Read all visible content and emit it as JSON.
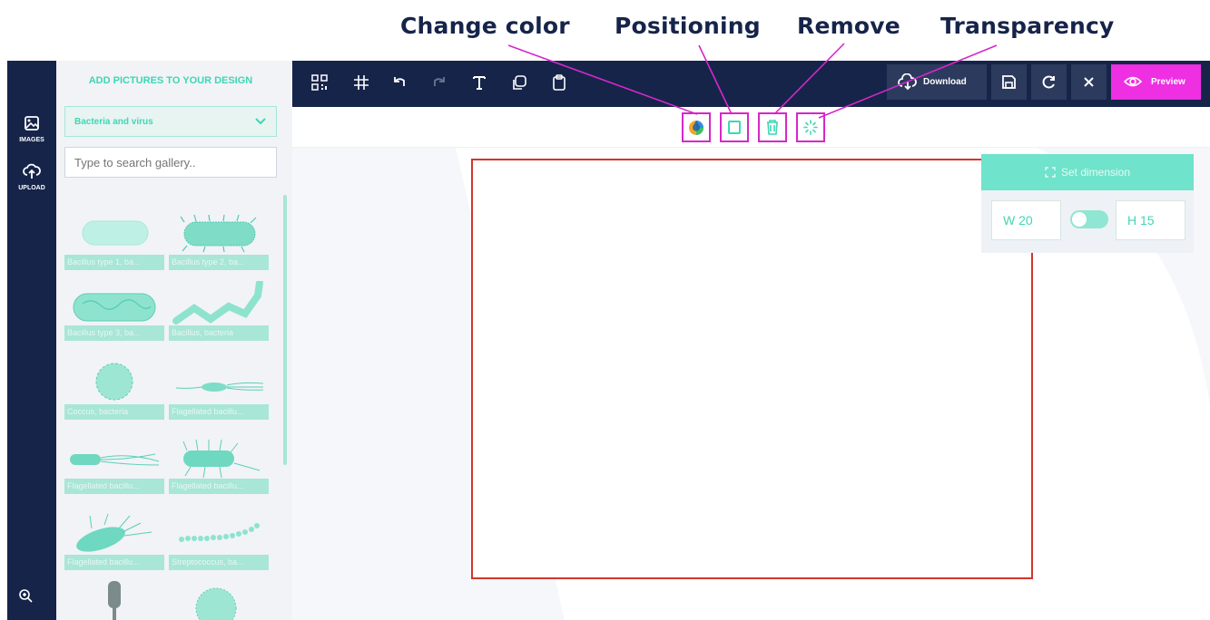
{
  "callouts": {
    "change_color": "Change color",
    "positioning": "Positioning",
    "remove": "Remove",
    "transparency": "Transparency"
  },
  "rail": {
    "images_label": "IMAGES",
    "upload_label": "UPLOAD",
    "icons": [
      "image-icon",
      "upload-cloud-icon",
      "zoom-in-icon"
    ]
  },
  "panel": {
    "title": "ADD PICTURES TO YOUR DESIGN",
    "category_selected": "Bacteria and virus",
    "search_placeholder": "Type to search gallery..",
    "items": [
      {
        "caption": "Bacillus type 1, ba...",
        "icon": "bacillus-smooth-icon"
      },
      {
        "caption": "Bacillus type 2, ba...",
        "icon": "bacillus-hairy-icon"
      },
      {
        "caption": "Bacillus type 3, ba...",
        "icon": "bacillus-wrinkled-icon"
      },
      {
        "caption": "Bacillus, bacteria",
        "icon": "bacillus-chain-icon"
      },
      {
        "caption": "Coccus, bacteria",
        "icon": "coccus-icon"
      },
      {
        "caption": "Flagellated bacillu...",
        "icon": "flagellated-bacillus-icon"
      },
      {
        "caption": "Flagellated bacillu...",
        "icon": "flagellated-bacillus-icon"
      },
      {
        "caption": "Flagellated bacillu...",
        "icon": "flagellated-bacillus-icon"
      },
      {
        "caption": "Flagellated bacillu...",
        "icon": "flagellated-bacillus-icon"
      },
      {
        "caption": "Streptococcus, ba...",
        "icon": "streptococcus-icon"
      }
    ]
  },
  "toolbar": {
    "icons": [
      "qr-code-icon",
      "grid-hash-icon",
      "undo-icon",
      "redo-icon",
      "text-icon",
      "duplicate-icon",
      "clipboard-icon"
    ],
    "download_label": "Download",
    "preview_label": "Preview"
  },
  "context_actions": [
    "change-color-icon",
    "positioning-icon",
    "remove-icon",
    "transparency-icon"
  ],
  "dimension": {
    "title": "Set dimension",
    "width": "W 20",
    "height": "H 15"
  },
  "colors": {
    "navy": "#16244a",
    "mint": "#3fd6b4",
    "magenta": "#ee2fe2",
    "artboard_border": "#d2352b"
  }
}
